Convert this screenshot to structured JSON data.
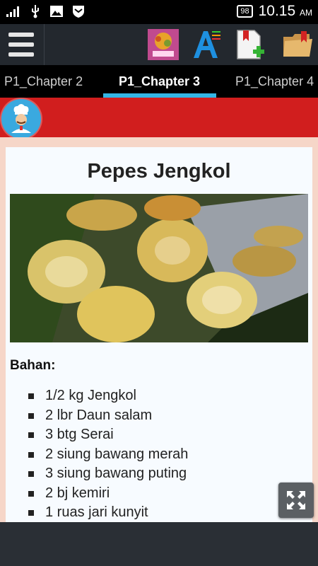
{
  "status_bar": {
    "battery": "98",
    "time": "10.15",
    "ampm": "AM"
  },
  "action_bar": {
    "icons": [
      "menu-icon",
      "cookbook-thumbnail-icon",
      "font-size-icon",
      "add-bookmark-icon",
      "bookmark-folder-icon"
    ]
  },
  "tabs": [
    {
      "label": "P1_Chapter 2"
    },
    {
      "label": "P1_Chapter 3"
    },
    {
      "label": "P1_Chapter 4"
    }
  ],
  "active_tab": "P1_Chapter 3",
  "recipe": {
    "title": "Pepes Jengkol",
    "section_label": "Bahan:",
    "ingredients": [
      "1/2 kg Jengkol",
      "2 lbr Daun salam",
      "3 btg Serai",
      "2 siung bawang merah",
      "3 siung bawang puting",
      "2 bj kemiri",
      "1 ruas jari kunyit"
    ]
  },
  "colors": {
    "accent": "#33b5e5",
    "header_red": "#d11e1e",
    "background": "#2a2f35"
  }
}
